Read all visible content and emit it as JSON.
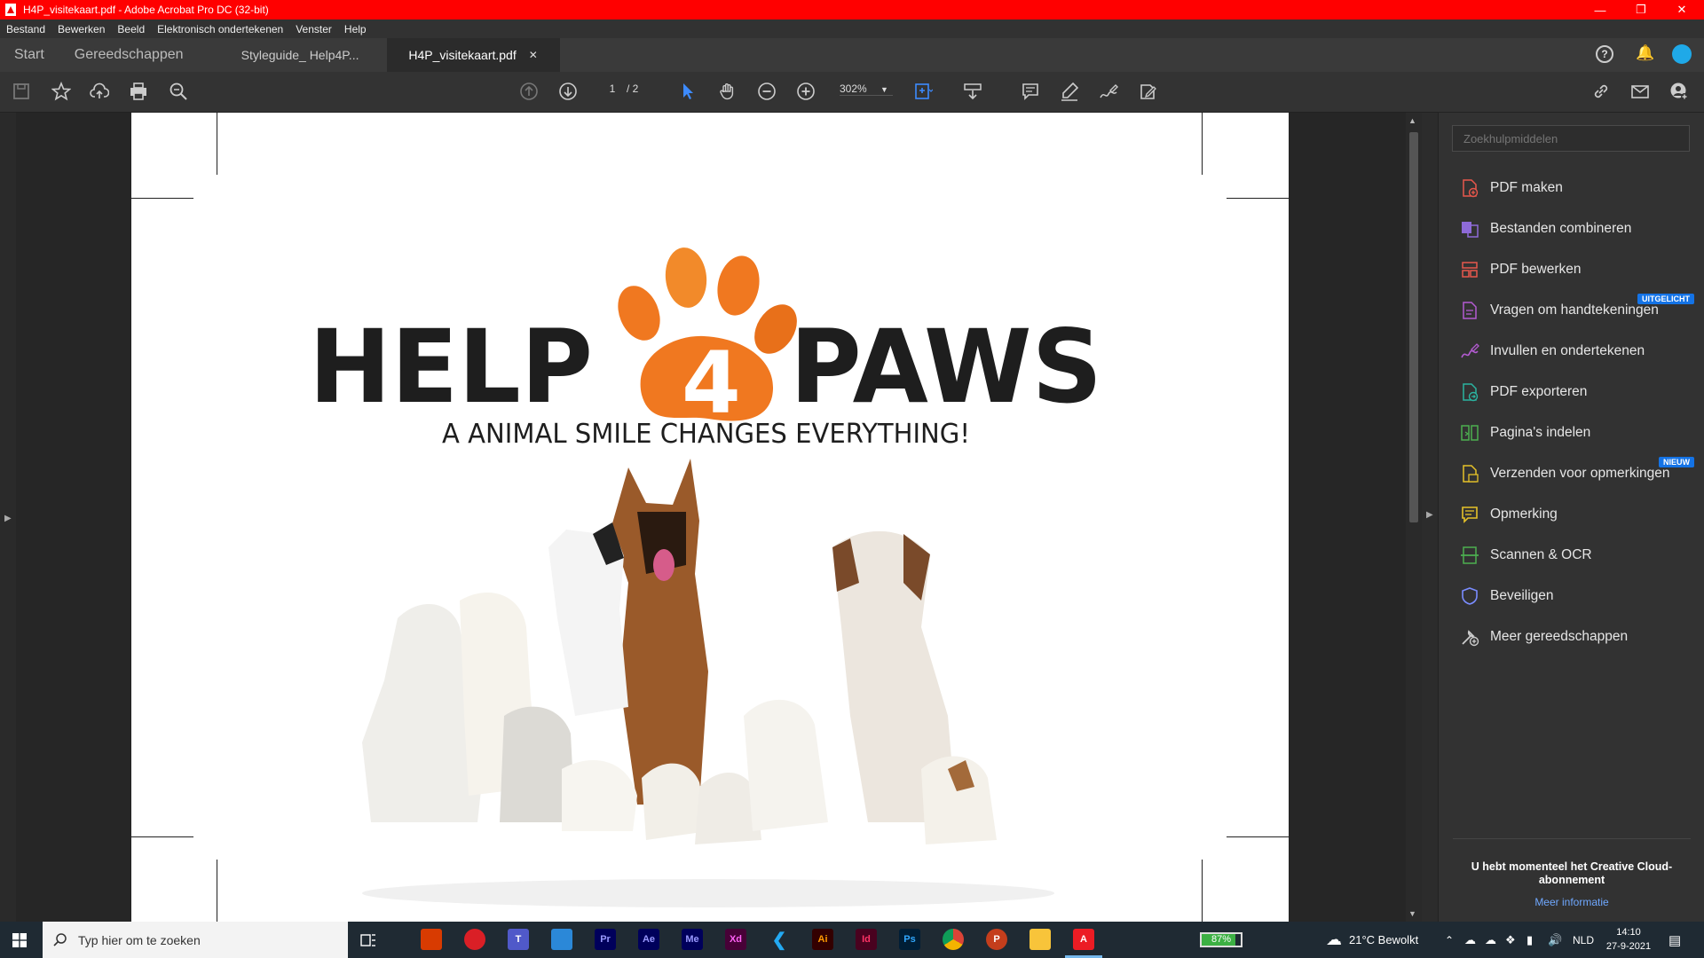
{
  "window": {
    "title": "H4P_visitekaart.pdf - Adobe Acrobat Pro DC (32-bit)"
  },
  "menu": [
    "Bestand",
    "Bewerken",
    "Beeld",
    "Elektronisch ondertekenen",
    "Venster",
    "Help"
  ],
  "tabs": {
    "home": "Start",
    "tools": "Gereedschappen",
    "doc1": "Styleguide_ Help4P...",
    "doc2": "H4P_visitekaart.pdf"
  },
  "toolbar": {
    "page_current": "1",
    "page_total": "/ 2",
    "zoom": "302%"
  },
  "document": {
    "logo_left": "HELP",
    "logo_number": "4",
    "logo_right": "PAWS",
    "slogan": "A ANIMAL SMILE CHANGES EVERYTHING!",
    "brand_color": "#f07820",
    "text_color": "#1e1e1e"
  },
  "rightpanel": {
    "search_placeholder": "Zoekhulpmiddelen",
    "tools": [
      {
        "label": "PDF maken",
        "icon": "create-pdf-icon",
        "color": "#e8574c"
      },
      {
        "label": "Bestanden combineren",
        "icon": "combine-files-icon",
        "color": "#8e6bd8"
      },
      {
        "label": "PDF bewerken",
        "icon": "edit-pdf-icon",
        "color": "#e8574c"
      },
      {
        "label": "Vragen om handtekeningen",
        "icon": "request-signature-icon",
        "color": "#b35bd1",
        "badge": "UITGELICHT"
      },
      {
        "label": "Invullen en ondertekenen",
        "icon": "fill-sign-icon",
        "color": "#b35bd1"
      },
      {
        "label": "PDF exporteren",
        "icon": "export-pdf-icon",
        "color": "#2bb3a0"
      },
      {
        "label": "Pagina's indelen",
        "icon": "organize-pages-icon",
        "color": "#4caf50"
      },
      {
        "label": "Verzenden voor opmerkingen",
        "icon": "send-comments-icon",
        "color": "#e6c229",
        "badge": "NIEUW"
      },
      {
        "label": "Opmerking",
        "icon": "comment-icon",
        "color": "#e6c229"
      },
      {
        "label": "Scannen & OCR",
        "icon": "scan-ocr-icon",
        "color": "#4caf50"
      },
      {
        "label": "Beveiligen",
        "icon": "protect-icon",
        "color": "#7a8cff"
      },
      {
        "label": "Meer gereedschappen",
        "icon": "more-tools-icon",
        "color": "#cccccc"
      }
    ],
    "promo_text": "U hebt momenteel het Creative Cloud-abonnement",
    "promo_link": "Meer informatie"
  },
  "taskbar": {
    "search_placeholder": "Typ hier om te zoeken",
    "battery": "87%",
    "battery_level": 0.87,
    "weather": "21°C  Bewolkt",
    "language": "NLD",
    "time": "14:10",
    "date": "27-9-2021",
    "apps": [
      {
        "icon": "office-icon",
        "label": "",
        "bg": "#d83b01"
      },
      {
        "icon": "creative-cloud-icon",
        "label": "",
        "bg": "#da1f26"
      },
      {
        "icon": "teams-icon",
        "label": "",
        "bg": "#5059c9"
      },
      {
        "icon": "notepad-icon",
        "label": "",
        "bg": "#2b88d8"
      },
      {
        "icon": "premiere-icon",
        "label": "Pr",
        "bg": "#00005b"
      },
      {
        "icon": "after-effects-icon",
        "label": "Ae",
        "bg": "#00005b"
      },
      {
        "icon": "media-encoder-icon",
        "label": "Me",
        "bg": "#00005b"
      },
      {
        "icon": "xd-icon",
        "label": "Xd",
        "bg": "#470137"
      },
      {
        "icon": "vscode-icon",
        "label": "",
        "bg": "#1f2a33"
      },
      {
        "icon": "illustrator-icon",
        "label": "Ai",
        "bg": "#330000"
      },
      {
        "icon": "indesign-icon",
        "label": "Id",
        "bg": "#49021f"
      },
      {
        "icon": "photoshop-icon",
        "label": "Ps",
        "bg": "#001e36"
      },
      {
        "icon": "chrome-icon",
        "label": "",
        "bg": "#1f2a33"
      },
      {
        "icon": "powerpoint-icon",
        "label": "",
        "bg": "#c43e1c"
      },
      {
        "icon": "file-explorer-icon",
        "label": "",
        "bg": "#f8c43a"
      },
      {
        "icon": "acrobat-icon",
        "label": "",
        "bg": "#ec1c24"
      }
    ]
  }
}
